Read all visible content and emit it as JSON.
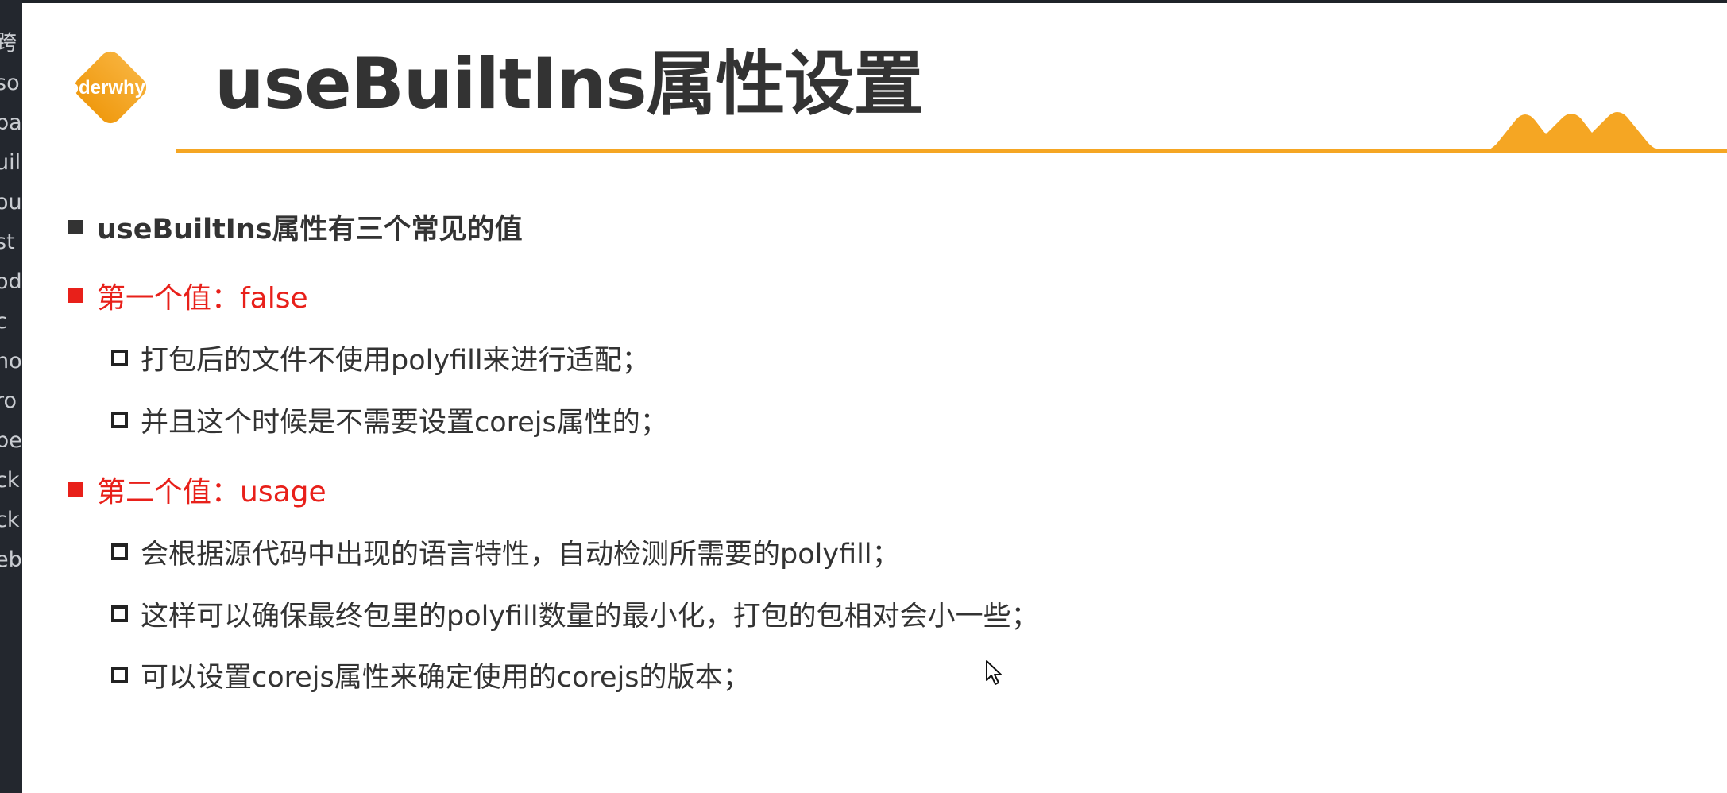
{
  "left_panel": {
    "fragments": [
      "跨",
      "so",
      "ba",
      "uil",
      "ou",
      "st",
      "od",
      "c",
      "no",
      "ro",
      "be",
      "ck",
      "ck",
      "eb"
    ]
  },
  "slide": {
    "logo_text": "coderwhy",
    "title": "useBuiltIns属性设置",
    "accent_color": "#f5a623",
    "heading_color": "#333333",
    "highlight_color": "#e8201a",
    "bullets": [
      {
        "level": 1,
        "style": "dark",
        "text": "useBuiltIns属性有三个常见的值"
      },
      {
        "level": 1,
        "style": "red",
        "text": "第一个值：false"
      },
      {
        "level": 2,
        "style": "item",
        "text": "打包后的文件不使用polyfill来进行适配；"
      },
      {
        "level": 2,
        "style": "item",
        "text": "并且这个时候是不需要设置corejs属性的；"
      },
      {
        "level": 1,
        "style": "red",
        "text": "第二个值：usage"
      },
      {
        "level": 2,
        "style": "item",
        "text": "会根据源代码中出现的语言特性，自动检测所需要的polyfill；"
      },
      {
        "level": 2,
        "style": "item",
        "text": "这样可以确保最终包里的polyfill数量的最小化，打包的包相对会小一些；"
      },
      {
        "level": 2,
        "style": "item",
        "text": "可以设置corejs属性来确定使用的corejs的版本；"
      }
    ]
  }
}
